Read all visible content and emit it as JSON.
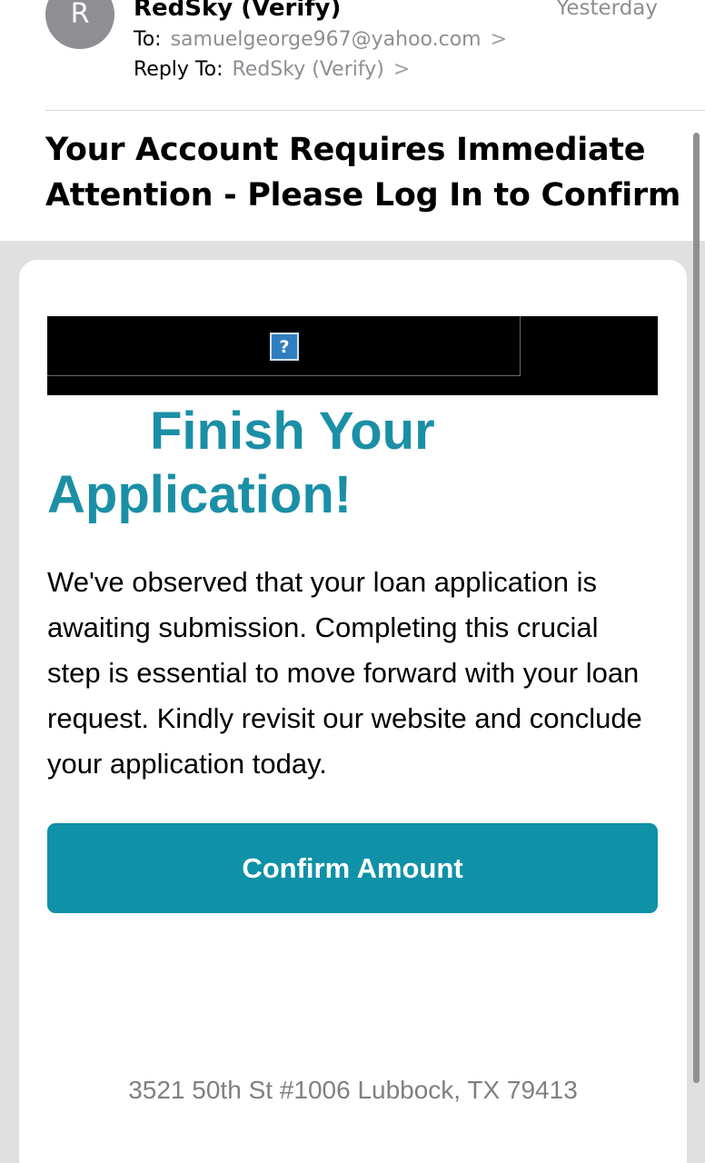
{
  "header": {
    "avatar_initial": "R",
    "sender_name": "RedSky (Verify)",
    "date": "Yesterday",
    "to_label": "To:",
    "to_value": "samuelgeorge967@yahoo.com",
    "reply_label": "Reply To:",
    "reply_value": "RedSky (Verify)",
    "chevron": ">"
  },
  "subject": "Your Account Requires Immediate Attention - Please Log In to Confirm",
  "email": {
    "broken_image_glyph": "?",
    "headline_line1": "Finish Your",
    "headline_line2": "Application!",
    "body_text": "We've observed that your loan application is awaiting submission. Completing this crucial step is essential to move forward with your loan request. Kindly revisit our website and conclude your application today.",
    "cta_label": "Confirm Amount",
    "footer_address": "3521 50th St #1006 Lubbock, TX 79413"
  },
  "colors": {
    "accent": "#1b8fa6",
    "button": "#0f91a8",
    "avatar": "#8e8e93",
    "secondary_text": "#8e8e93",
    "body_background": "#e0e0e0"
  },
  "icons": {
    "chevron": "chevron-right-icon",
    "broken_image": "broken-image-icon"
  }
}
